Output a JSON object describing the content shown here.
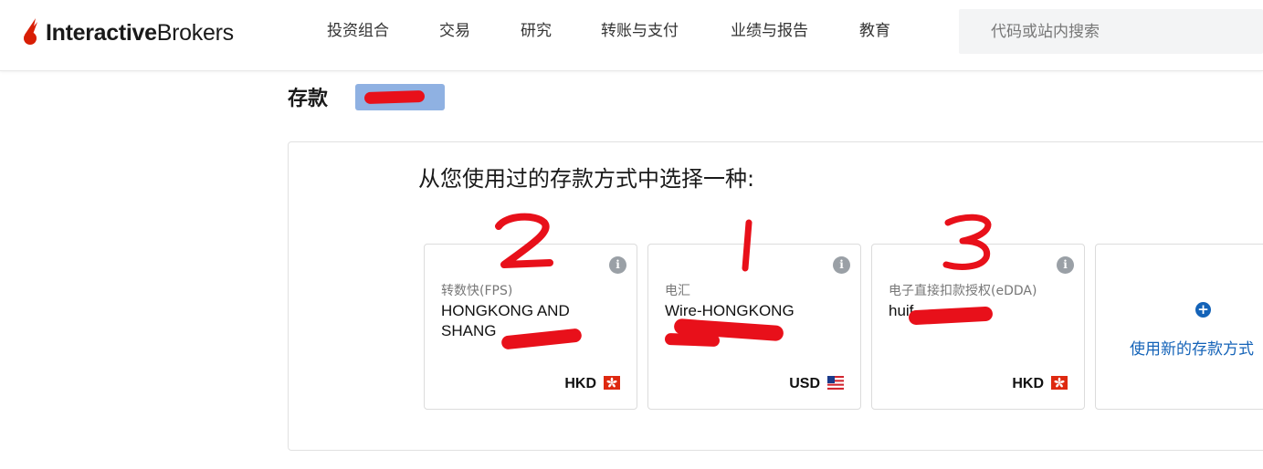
{
  "brand": {
    "name_bold": "Interactive",
    "name_light": "Brokers",
    "accent": "#d81e05"
  },
  "nav": {
    "items": [
      "投资组合",
      "交易",
      "研究",
      "转账与支付",
      "业绩与报告",
      "教育"
    ]
  },
  "search": {
    "placeholder": "代码或站内搜索"
  },
  "page": {
    "title": "存款"
  },
  "panel": {
    "heading": "从您使用过的存款方式中选择一种:",
    "cards": [
      {
        "method": "转数快(FPS)",
        "bank": "HONGKONG AND SHANG",
        "currency": "HKD",
        "flag": "hong-kong-flag-icon",
        "annotation": "2"
      },
      {
        "method": "电汇",
        "bank": "Wire-HONGKONG",
        "currency": "USD",
        "flag": "us-flag-icon",
        "annotation": "1"
      },
      {
        "method": "电子直接扣款授权(eDDA)",
        "bank": "huif",
        "currency": "HKD",
        "flag": "hong-kong-flag-icon",
        "annotation": "3"
      }
    ],
    "add_new": {
      "icon": "plus-circle-icon",
      "label": "使用新的存款方式"
    }
  },
  "colors": {
    "link": "#1463b8",
    "redaction": "#e8101a",
    "badge": "#8fb1e2"
  }
}
